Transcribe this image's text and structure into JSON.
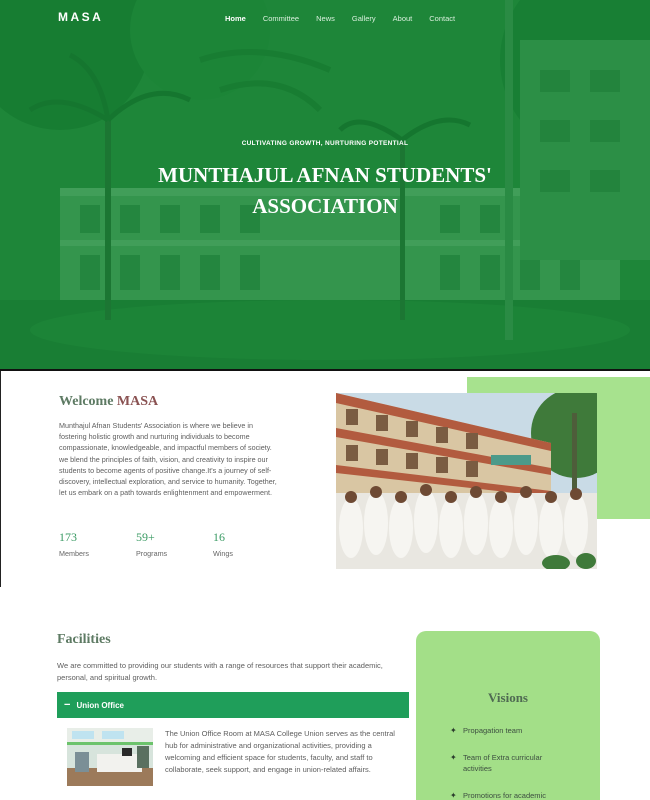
{
  "nav": {
    "logo": "MASA",
    "items": [
      "Home",
      "Committee",
      "News",
      "Gallery",
      "About",
      "Contact"
    ],
    "active_index": 0
  },
  "hero": {
    "tagline": "CULTIVATING GROWTH, NURTURING POTENTIAL",
    "title_line1": "MUNTHAJUL AFNAN STUDENTS'",
    "title_line2": "ASSOCIATION"
  },
  "welcome": {
    "title_prefix": "Welcome ",
    "title_accent": "MASA",
    "text": "Munthajul Afnan Students' Association is where we believe in fostering holistic growth and nurturing individuals to become compassionate, knowledgeable, and impactful members of society. we blend the principles of faith, vision, and creativity to inspire our students to become agents of positive change.It's a journey of self-discovery, intellectual exploration, and service to humanity. Together, let us embark on a path towards enlightenment and empowerment.",
    "stats": [
      {
        "value": "173",
        "label": "Members"
      },
      {
        "value": "59+",
        "label": "Programs"
      },
      {
        "value": "16",
        "label": "Wings"
      }
    ]
  },
  "facilities": {
    "title": "Facilities",
    "intro": "We are committed to providing our students with a range of resources that support their academic, personal, and spiritual growth.",
    "accordion": {
      "expanded_icon": "minus-icon",
      "label": "Union Office",
      "text": "The Union Office Room at MASA College Union serves as the central hub for administrative and organizational activities, providing a welcoming and efficient space for students, faculty, and staff to collaborate, seek support, and engage in union-related affairs."
    }
  },
  "visions": {
    "title": "Visions",
    "bullet_icon": "sparkle-icon",
    "items": [
      "Propagation team",
      "Team of Extra curricular activities",
      "Promotions for academic"
    ]
  },
  "colors": {
    "hero_green": "#1f8a3f",
    "accent_green": "#1f9e5a",
    "light_green": "#a7e28e"
  }
}
